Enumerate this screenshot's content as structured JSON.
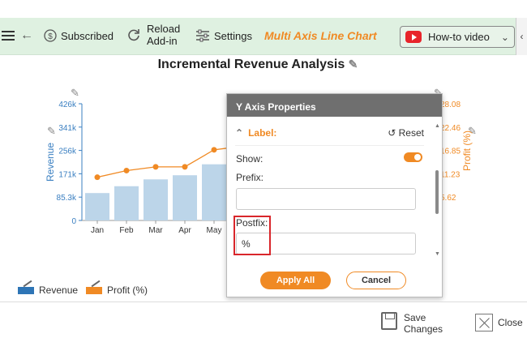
{
  "toolbar": {
    "back_label": "←",
    "subscribed_label": "Subscribed",
    "reload_label_1": "Reload",
    "reload_label_2": "Add-in",
    "settings_label": "Settings",
    "brand_label": "Multi Axis Line Chart",
    "howto_label": "How-to video"
  },
  "chart_title": "Incremental Revenue Analysis",
  "chart_data": {
    "type": "bar",
    "categories": [
      "Jan",
      "Feb",
      "Mar",
      "Apr",
      "May"
    ],
    "series": [
      {
        "name": "Revenue",
        "type": "bar",
        "axis": "left",
        "values": [
          100000,
          125000,
          150000,
          165000,
          205000
        ],
        "color": "#bcd5e9"
      },
      {
        "name": "Profit (%)",
        "type": "line",
        "axis": "right",
        "values": [
          10.4,
          12.0,
          12.9,
          12.9,
          17.0
        ],
        "color": "#f08a24"
      }
    ],
    "left_axis": {
      "label": "Revenue",
      "ticks": [
        "0",
        "85.3k",
        "171k",
        "256k",
        "341k",
        "426k"
      ],
      "range": [
        0,
        426000
      ],
      "color": "#3a7fc1"
    },
    "right_axis": {
      "label": "Profit (%)",
      "ticks": [
        "5.62",
        "11.23",
        "16.85",
        "22.46",
        "28.08"
      ],
      "range": [
        0,
        28.08
      ],
      "color": "#f08a24"
    }
  },
  "legend": {
    "revenue_label": "Revenue",
    "profit_label": "Profit (%)",
    "revenue_color": "#2e75b6",
    "profit_color": "#f08a24"
  },
  "dialog": {
    "title": "Y Axis Properties",
    "section_label": "Label:",
    "reset_label": "Reset",
    "show_label": "Show:",
    "show_value": true,
    "prefix_label": "Prefix:",
    "prefix_value": "",
    "postfix_label": "Postfix:",
    "postfix_value": "%",
    "apply_label": "Apply All",
    "cancel_label": "Cancel"
  },
  "bottom": {
    "save_label_1": "Save",
    "save_label_2": "Changes",
    "close_label": "Close"
  }
}
